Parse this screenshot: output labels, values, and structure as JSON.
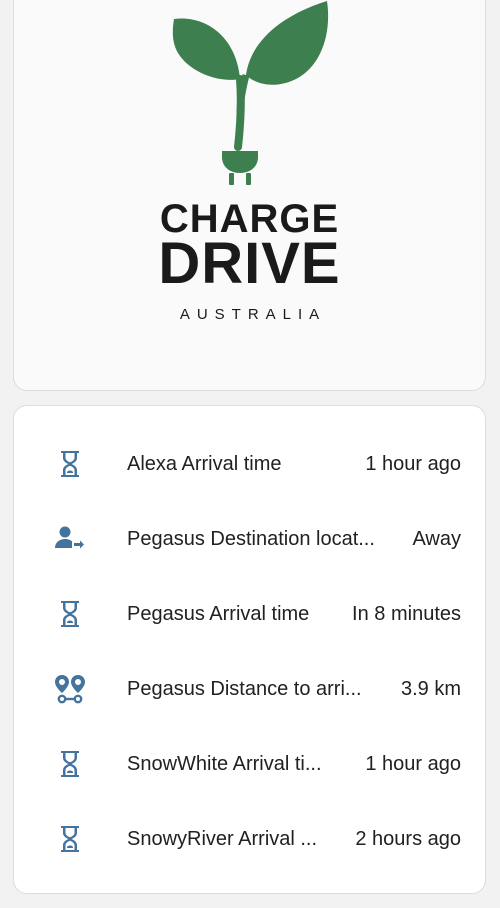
{
  "logo": {
    "line1": "CHARGE",
    "line2": "DRIVE",
    "line3": "AUSTRALIA",
    "leaf_color": "#3d7f4f",
    "text_color": "#1a1a1a"
  },
  "entities": [
    {
      "icon": "timer-sand-icon",
      "name": "Alexa Arrival time",
      "state": "1 hour ago"
    },
    {
      "icon": "account-arrow-right-icon",
      "name": "Pegasus Destination locat...",
      "state": "Away"
    },
    {
      "icon": "timer-sand-icon",
      "name": "Pegasus Arrival time",
      "state": "In 8 minutes"
    },
    {
      "icon": "map-marker-distance-icon",
      "name": "Pegasus Distance to arri...",
      "state": "3.9 km"
    },
    {
      "icon": "timer-sand-icon",
      "name": "SnowWhite Arrival ti...",
      "state": "1 hour ago"
    },
    {
      "icon": "timer-sand-icon",
      "name": "SnowyRiver Arrival ...",
      "state": "2 hours ago"
    }
  ],
  "colors": {
    "icon": "#44739e",
    "card_border": "#dcdcdc",
    "background": "#f2f2f2"
  }
}
